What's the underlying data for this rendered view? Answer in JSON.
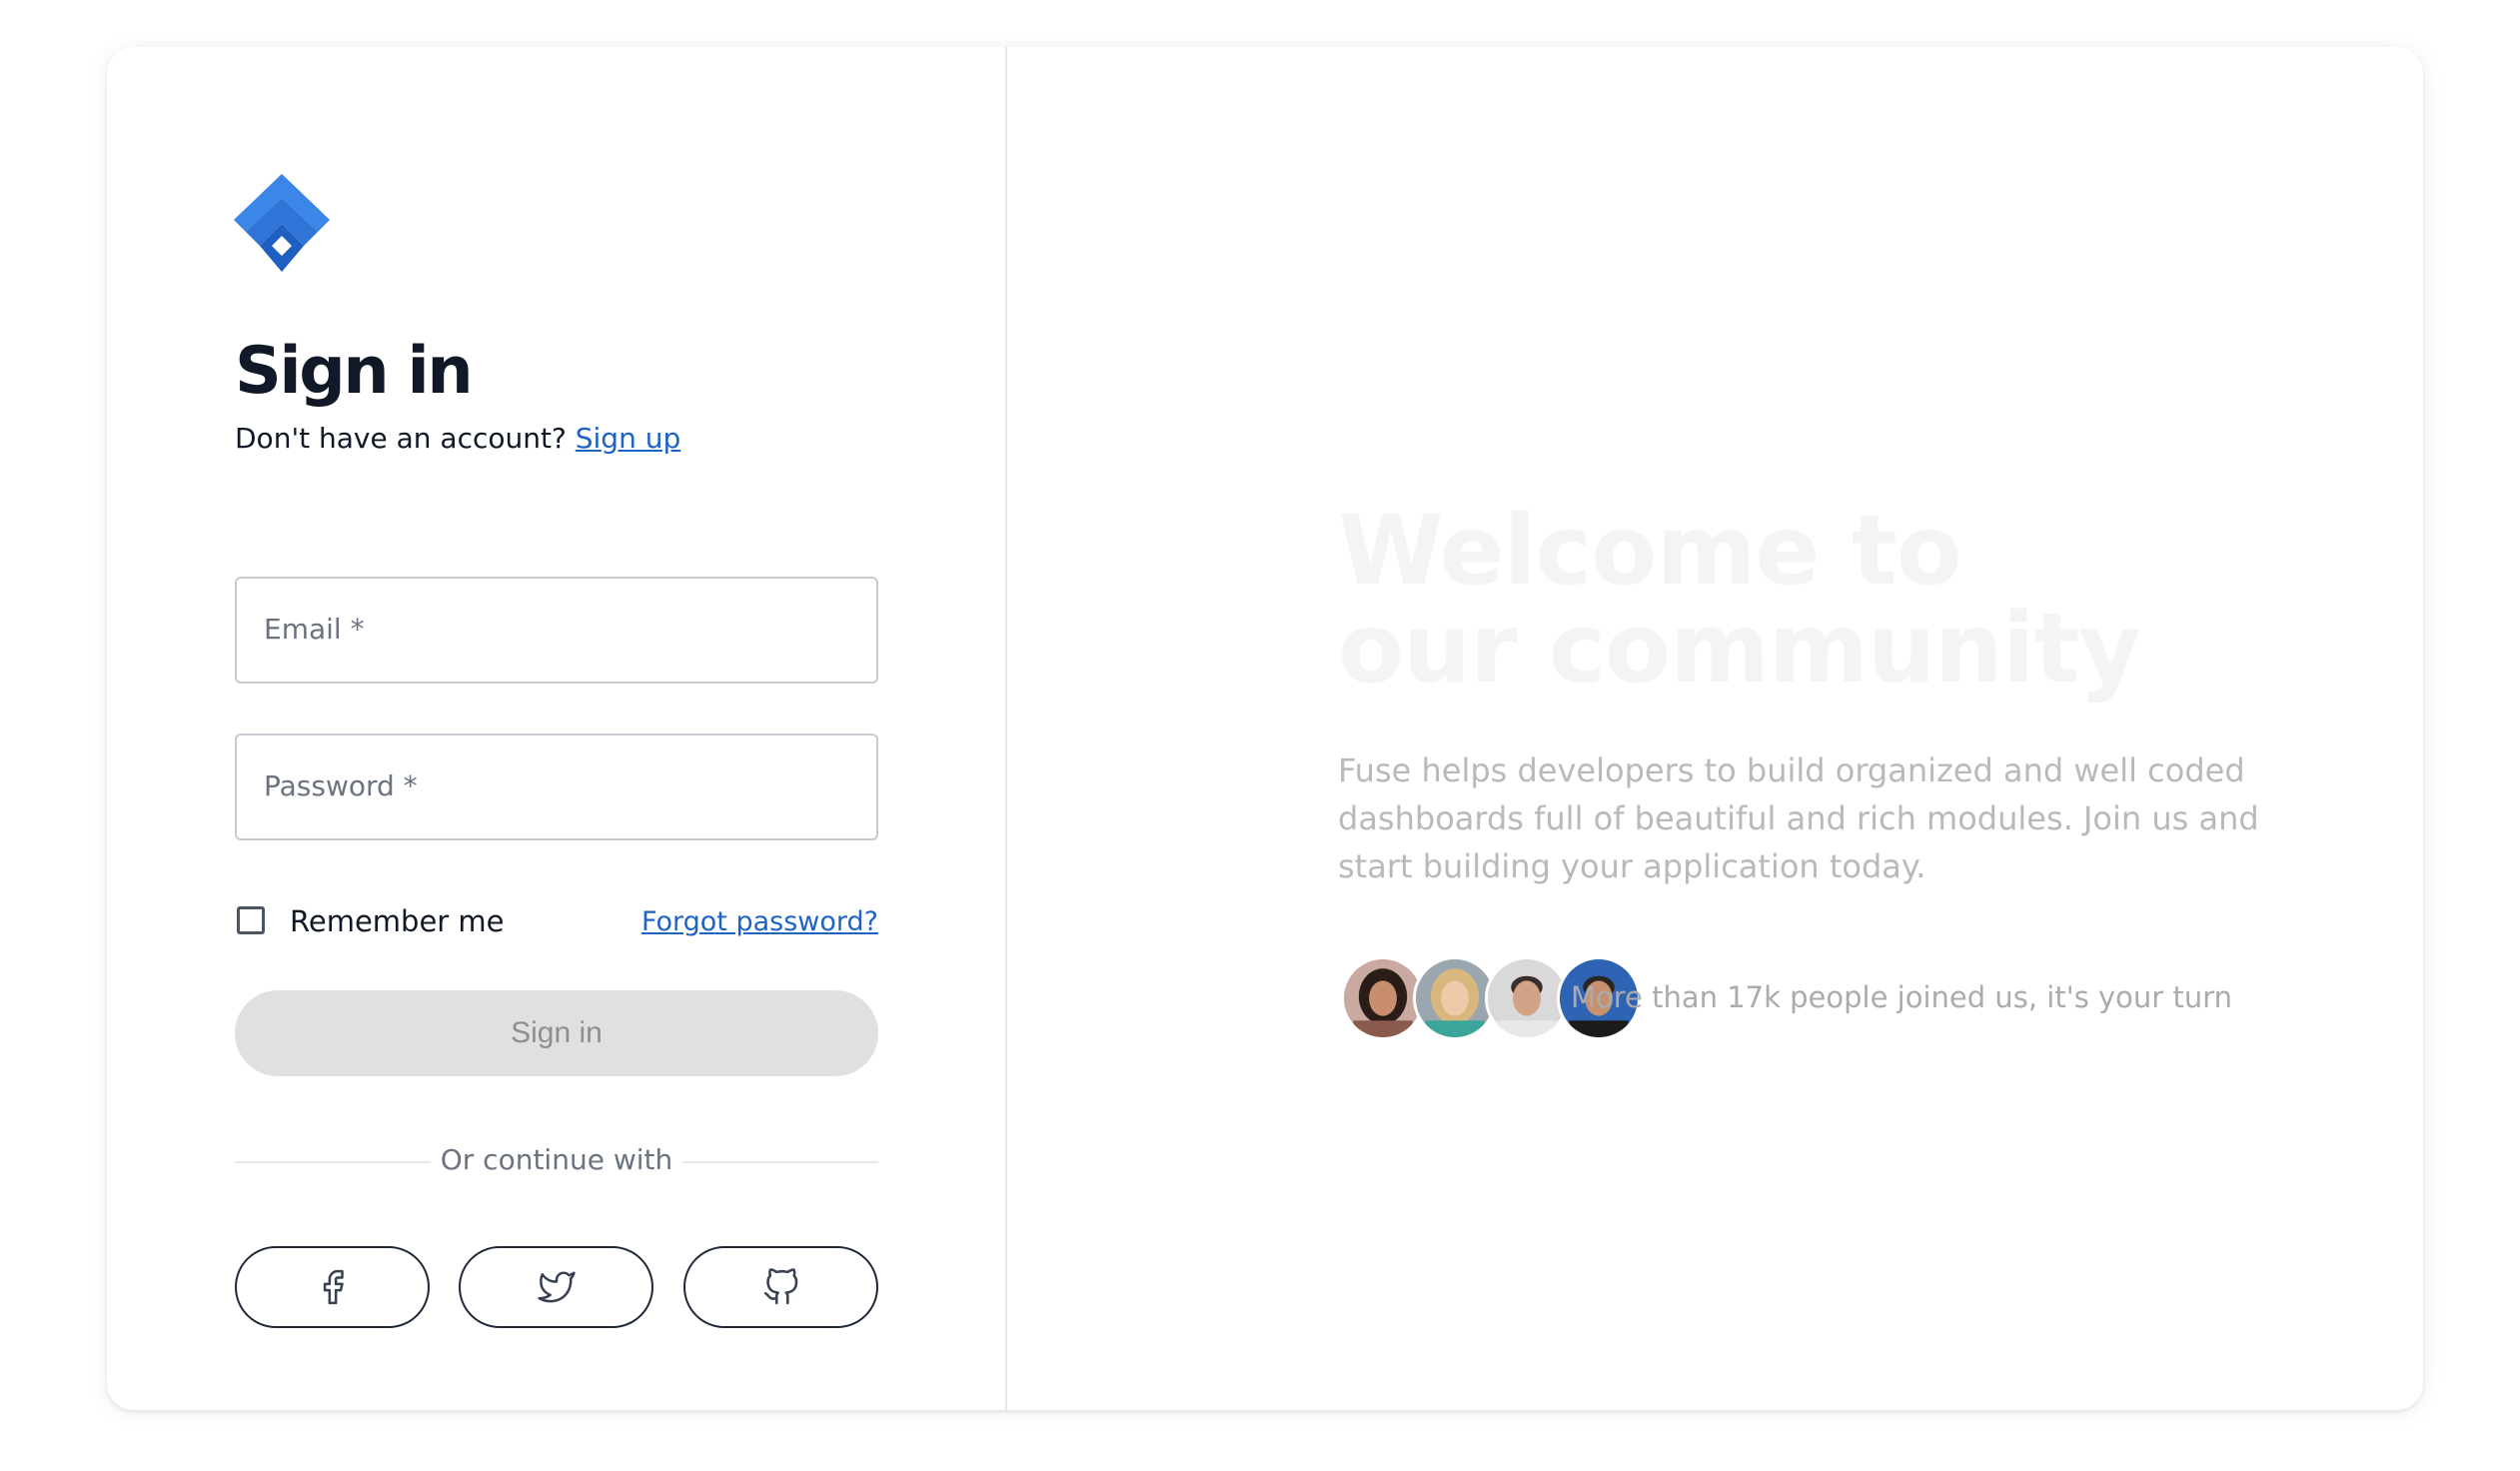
{
  "app": {
    "logo_icon": "fuse-logo-icon",
    "brand_color": "#2f7de1"
  },
  "signin": {
    "title": "Sign in",
    "no_account_text": "Don't have an account?",
    "signup_link": "Sign up",
    "email": {
      "placeholder": "Email *",
      "value": ""
    },
    "password": {
      "placeholder": "Password *",
      "value": ""
    },
    "remember_label": "Remember me",
    "remember_checked": false,
    "forgot_link": "Forgot password?",
    "submit_label": "Sign in",
    "submit_disabled": true,
    "divider_text": "Or continue with",
    "social": [
      {
        "icon": "facebook-icon"
      },
      {
        "icon": "twitter-icon"
      },
      {
        "icon": "github-icon"
      }
    ]
  },
  "promo": {
    "headline_line1": "Welcome to",
    "headline_line2": "our community",
    "description": "Fuse helps developers to build organized and well coded dashboards full of beautiful and rich modules. Join us and start building your application today.",
    "avatars": [
      "avatar-1",
      "avatar-2",
      "avatar-3",
      "avatar-4"
    ],
    "joined_text": "More than 17k people joined us, it's your turn"
  },
  "colors": {
    "link": "#1e63c6",
    "heading": "#111827",
    "disabled_button_bg": "#e0e0e0"
  }
}
